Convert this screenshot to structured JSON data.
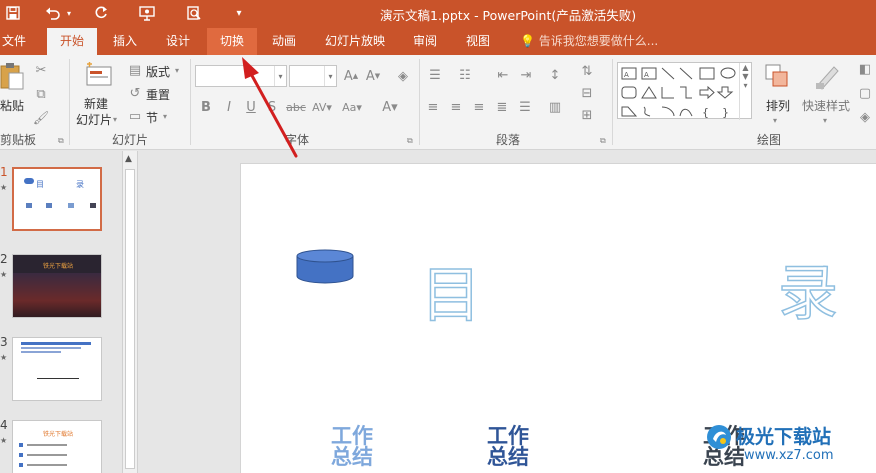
{
  "titlebar": {
    "title": "演示文稿1.pptx - PowerPoint(产品激活失败)",
    "icons": [
      "save-icon",
      "undo-icon",
      "redo-icon",
      "present-icon",
      "preview-icon",
      "customize-icon"
    ]
  },
  "tabs": [
    {
      "label": "文件"
    },
    {
      "label": "开始"
    },
    {
      "label": "插入"
    },
    {
      "label": "设计"
    },
    {
      "label": "切换"
    },
    {
      "label": "动画"
    },
    {
      "label": "幻灯片放映"
    },
    {
      "label": "审阅"
    },
    {
      "label": "视图"
    }
  ],
  "active_tab": "开始",
  "highlighted_tab": "切换",
  "tell_me": "告诉我您想要做什么...",
  "ribbon": {
    "clipboard": {
      "paste": "粘贴",
      "group": "剪贴板"
    },
    "slides": {
      "new_slide_line1": "新建",
      "new_slide_line2": "幻灯片",
      "layout": "版式",
      "reset": "重置",
      "section": "节",
      "group": "幻灯片"
    },
    "font": {
      "group": "字体"
    },
    "paragraph": {
      "group": "段落"
    },
    "drawing": {
      "arrange": "排列",
      "quick_styles": "快速样式",
      "group": "绘图"
    }
  },
  "thumbnails": [
    {
      "number": "1",
      "title": "目",
      "subtitle": "录"
    },
    {
      "number": "2",
      "title": "铁光下载站"
    },
    {
      "number": "3"
    },
    {
      "number": "4",
      "title": "铁光下载站"
    }
  ],
  "slide": {
    "title_left": "目",
    "title_right": "录",
    "items": [
      {
        "line1": "工作",
        "line2": "总结"
      },
      {
        "line1": "工作",
        "line2": "总结"
      },
      {
        "line1": "工作",
        "line2": "总结"
      }
    ]
  },
  "watermark": {
    "name": "极光下载站",
    "url": "www.xz7.com"
  },
  "colors": {
    "accent": "#c9532a",
    "shape": "#4472c4",
    "text_outline": "#8fbfe0",
    "dark_text": "#2f5597"
  }
}
